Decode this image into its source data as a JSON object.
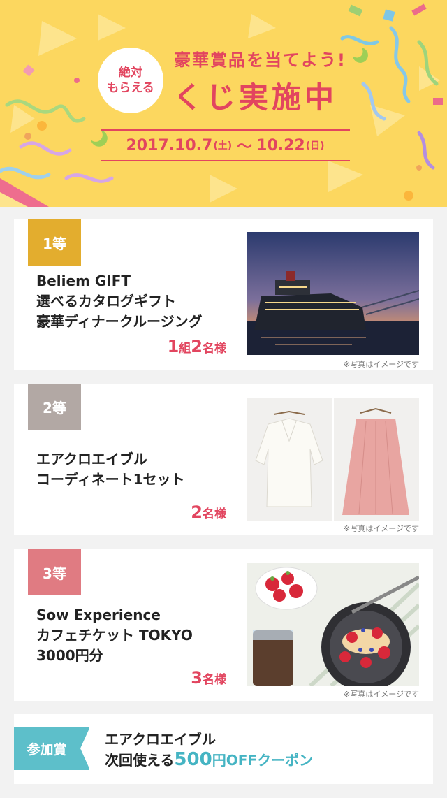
{
  "header": {
    "badge_line1": "絶対",
    "badge_line2": "もらえる",
    "subtitle": "豪華賞品を当てよう!",
    "title": "くじ実施中",
    "date_start": "2017.10.7",
    "date_start_day": "(土)",
    "date_sep": "〜",
    "date_end": "10.22",
    "date_end_day": "(日)"
  },
  "prizes": [
    {
      "rank": "1等",
      "rank_color": "#e3ad2e",
      "lines": [
        "Beliem GIFT",
        "選べるカタログギフト",
        "豪華ディナークルージング"
      ],
      "winners_a_num": "1",
      "winners_a_unit": "組",
      "winners_b_num": "2",
      "winners_b_unit": "名様",
      "note": "※写真はイメージです",
      "image_icon": "cruise-ship-photo"
    },
    {
      "rank": "2等",
      "rank_color": "#b2a8a4",
      "lines": [
        "エアクロエイブル",
        "コーディネート1セット"
      ],
      "winners_num": "2",
      "winners_unit": "名様",
      "note": "※写真はイメージです",
      "image_icon": "clothing-photo"
    },
    {
      "rank": "3等",
      "rank_color": "#e07b82",
      "lines": [
        "Sow Experience",
        "カフェチケット TOKYO",
        "3000円分"
      ],
      "winners_num": "3",
      "winners_unit": "名様",
      "note": "※写真はイメージです",
      "image_icon": "pancake-photo"
    }
  ],
  "participation": {
    "tag": "参加賞",
    "line1": "エアクロエイブル",
    "line2_prefix": "次回使える",
    "line2_amount": "500",
    "line2_yen": "円",
    "line2_off": "OFFクーポン",
    "accent": "#45b4c3"
  },
  "colors": {
    "background": "#fcd75f",
    "accent": "#e2455f"
  }
}
